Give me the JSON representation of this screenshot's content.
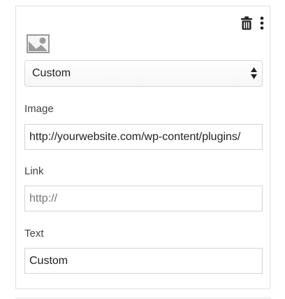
{
  "toolbar": {
    "delete_icon": "trash-icon",
    "more_icon": "vertical-ellipsis-icon"
  },
  "media": {
    "icon": "image-placeholder-icon"
  },
  "type_select": {
    "selected": "Custom"
  },
  "fields": {
    "image": {
      "label": "Image",
      "value": "http://yourwebsite.com/wp-content/plugins/"
    },
    "link": {
      "label": "Link",
      "value": "http://"
    },
    "text": {
      "label": "Text",
      "value": "Custom"
    }
  }
}
